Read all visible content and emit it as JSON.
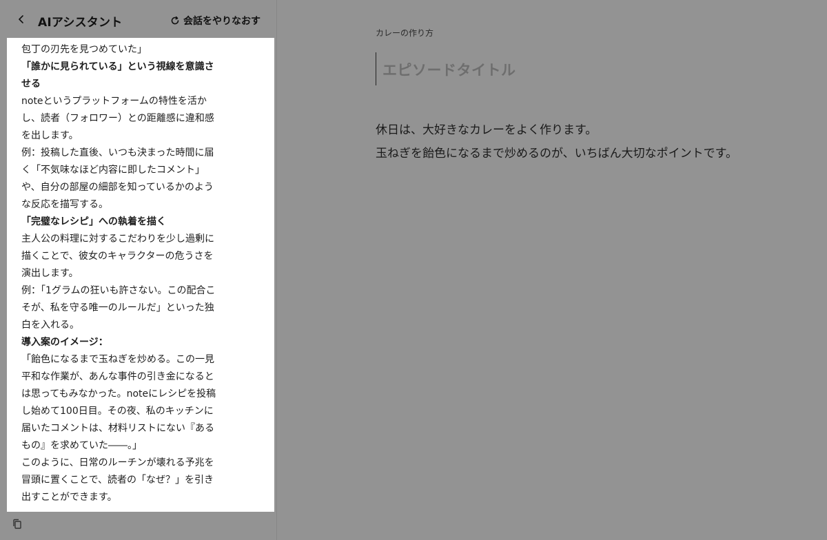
{
  "panel": {
    "title": "AIアシスタント",
    "reset_label": "会話をやりなおす",
    "icons": {
      "back": "chevron-left-icon",
      "reset": "refresh-icon",
      "copy": "copy-icon"
    },
    "messages": [
      {
        "text": "包丁の刃先を見つめていた」",
        "bold": false
      },
      {
        "text": "「誰かに見られている」という視線を意識さ",
        "bold": true
      },
      {
        "text": "せる",
        "bold": true
      },
      {
        "text": "noteというプラットフォームの特性を活か",
        "bold": false
      },
      {
        "text": "し、読者（フォロワー）との距離感に違和感",
        "bold": false
      },
      {
        "text": "を出します。",
        "bold": false
      },
      {
        "text": "例：投稿した直後、いつも決まった時間に届",
        "bold": false
      },
      {
        "text": "く「不気味なほど内容に即したコメント」",
        "bold": false
      },
      {
        "text": "や、自分の部屋の細部を知っているかのよう",
        "bold": false
      },
      {
        "text": "な反応を描写する。",
        "bold": false
      },
      {
        "text": "「完璧なレシピ」への執着を描く",
        "bold": true
      },
      {
        "text": "主人公の料理に対するこだわりを少し過剰に",
        "bold": false
      },
      {
        "text": "描くことで、彼女のキャラクターの危うさを",
        "bold": false
      },
      {
        "text": "演出します。",
        "bold": false
      },
      {
        "text": "例：「1グラムの狂いも許さない。この配合こ",
        "bold": false
      },
      {
        "text": "そが、私を守る唯一のルールだ」といった独",
        "bold": false
      },
      {
        "text": "白を入れる。",
        "bold": false
      },
      {
        "text": "導入案のイメージ：",
        "bold": true
      },
      {
        "text": "「飴色になるまで玉ねぎを炒める。この一見",
        "bold": false
      },
      {
        "text": "平和な作業が、あんな事件の引き金になると",
        "bold": false
      },
      {
        "text": "は思ってもみなかった。noteにレシピを投稿",
        "bold": false
      },
      {
        "text": "し始めて100日目。その夜、私のキッチンに",
        "bold": false
      },
      {
        "text": "届いたコメントは、材料リストにない『ある",
        "bold": false
      },
      {
        "text": "もの』を求めていた――。」",
        "bold": false
      },
      {
        "text": "このように、日常のルーチンが壊れる予兆を",
        "bold": false
      },
      {
        "text": "冒頭に置くことで、読者の「なぜ？」を引き",
        "bold": false
      },
      {
        "text": "出すことができます。",
        "bold": false
      }
    ]
  },
  "editor": {
    "breadcrumb": "カレーの作り方",
    "title_placeholder": "エピソードタイトル",
    "body": [
      "休日は、大好きなカレーをよく作ります。",
      "玉ねぎを飴色になるまで炒めるのが、いちばん大切なポイントです。"
    ]
  }
}
